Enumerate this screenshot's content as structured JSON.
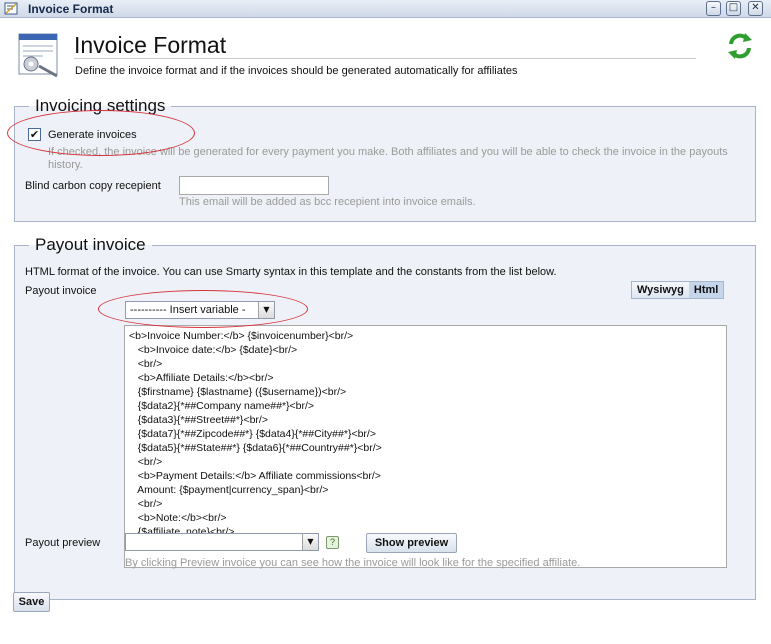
{
  "window": {
    "title": "Invoice Format",
    "controls": {
      "minimize": "–",
      "maximize": "□",
      "close": "✕"
    }
  },
  "header": {
    "title": "Invoice Format",
    "description": "Define the invoice format and if the invoices should be generated automatically for affiliates",
    "icon": "invoice-format-icon",
    "refresh_icon": "refresh-icon"
  },
  "invoicing": {
    "legend": "Invoicing settings",
    "generate_label": "Generate invoices",
    "generate_checked": true,
    "generate_hint_1": "If checked, the invoice will be generated for every payment you make. Both affiliates and you will be able to check the invoice in the payouts",
    "generate_hint_2": "history.",
    "bcc_label": "Blind carbon copy recepient",
    "bcc_value": "",
    "bcc_hint": "This email will be added as bcc recepient into invoice emails."
  },
  "payout": {
    "legend": "Payout invoice",
    "description": "HTML format of the invoice. You can use Smarty syntax in this template and the constants from the list below.",
    "field_label": "Payout invoice",
    "mode_wysiwyg": "Wysiwyg",
    "mode_html": "Html",
    "insert_variable": "----------  Insert variable  -",
    "code_lines": [
      "<b>Invoice Number:</b> {$invoicenumber}<br/>",
      "   <b>Invoice date:</b> {$date}<br/>",
      "   <br/>",
      "   <b>Affiliate Details:</b><br/>",
      "   {$firstname} {$lastname} ({$username})<br/>",
      "   {$data2}{*##Company name##*}<br/>",
      "   {$data3}{*##Street##*}<br/>",
      "   {$data7}{*##Zipcode##*} {$data4}{*##City##*}<br/>",
      "   {$data5}{*##State##*} {$data6}{*##Country##*}<br/>",
      "   <br/>",
      "   <b>Payment Details:</b> Affiliate commissions<br/>",
      "   Amount: {$payment|currency_span}<br/>",
      "   <br/>",
      "   <b>Note:</b><br/>",
      "   {$affiliate_note}<br/>"
    ],
    "preview_label": "Payout preview",
    "preview_value": "",
    "help": "?",
    "show_preview": "Show preview",
    "preview_hint": "By clicking Preview invoice you can see how the invoice will look like for the specified affiliate."
  },
  "footer": {
    "save_label": "Save"
  },
  "colors": {
    "annotation": "#d6333a",
    "panel_bg": "#eef1f7",
    "panel_border": "#a7b4c9"
  }
}
